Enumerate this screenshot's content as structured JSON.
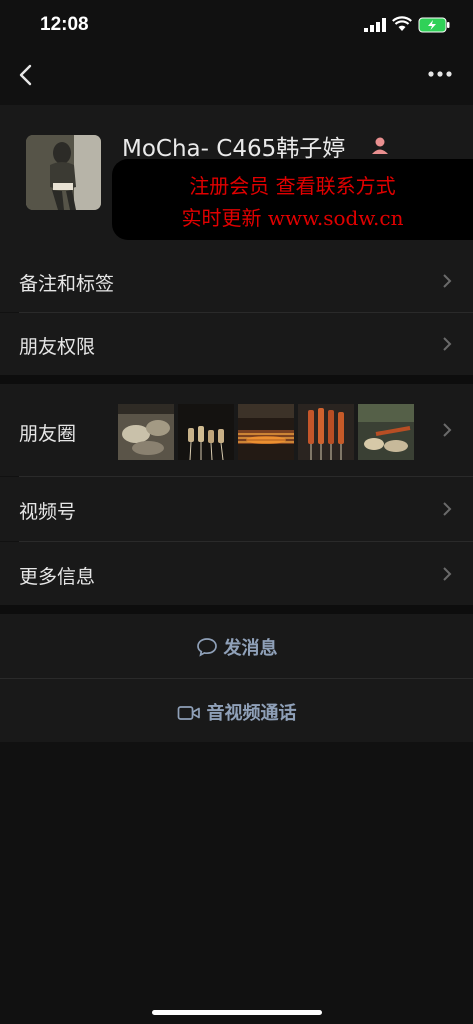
{
  "status_bar": {
    "time": "12:08"
  },
  "profile": {
    "name": "MoCha- C465韩子婷",
    "gender_icon": "female-icon"
  },
  "ad_banner": {
    "line1": "注册会员 查看联系方式",
    "line2": "实时更新 www.sodw.cn"
  },
  "settings": {
    "remark_tags": "备注和标签",
    "friend_permissions": "朋友权限"
  },
  "info": {
    "moments": "朋友圈",
    "channels": "视频号",
    "more_info": "更多信息"
  },
  "actions": {
    "send_message": "发消息",
    "video_call": "音视频通话"
  },
  "colors": {
    "background": "#111111",
    "row": "#191919",
    "action_text": "#8fa0b8",
    "ad_text": "#e00000"
  }
}
